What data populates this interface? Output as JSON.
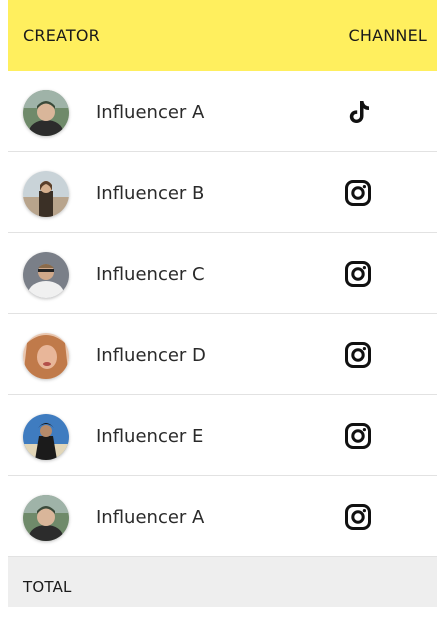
{
  "header": {
    "creator_label": "CREATOR",
    "channel_label": "CHANNEL",
    "background": "#FFEF5E"
  },
  "rows": [
    {
      "name": "Influencer A",
      "channel": "tiktok-icon",
      "avatar_colors": [
        "#6f8a6a",
        "#2c2c2c",
        "#d9b69a"
      ]
    },
    {
      "name": "Influencer B",
      "channel": "instagram-icon",
      "avatar_colors": [
        "#c9d3d8",
        "#3b3026",
        "#d6b08e"
      ]
    },
    {
      "name": "Influencer C",
      "channel": "instagram-icon",
      "avatar_colors": [
        "#7a7f88",
        "#f0f0f0",
        "#cfa88a"
      ]
    },
    {
      "name": "Influencer D",
      "channel": "instagram-icon",
      "avatar_colors": [
        "#e9c7b0",
        "#c07a4a",
        "#e8b699"
      ]
    },
    {
      "name": "Influencer E",
      "channel": "instagram-icon",
      "avatar_colors": [
        "#3f7cc0",
        "#1b1b1b",
        "#b58a6a"
      ]
    },
    {
      "name": "Influencer A",
      "channel": "instagram-icon",
      "avatar_colors": [
        "#6f8a6a",
        "#2c2c2c",
        "#d9b69a"
      ]
    }
  ],
  "footer": {
    "total_label": "TOTAL"
  }
}
